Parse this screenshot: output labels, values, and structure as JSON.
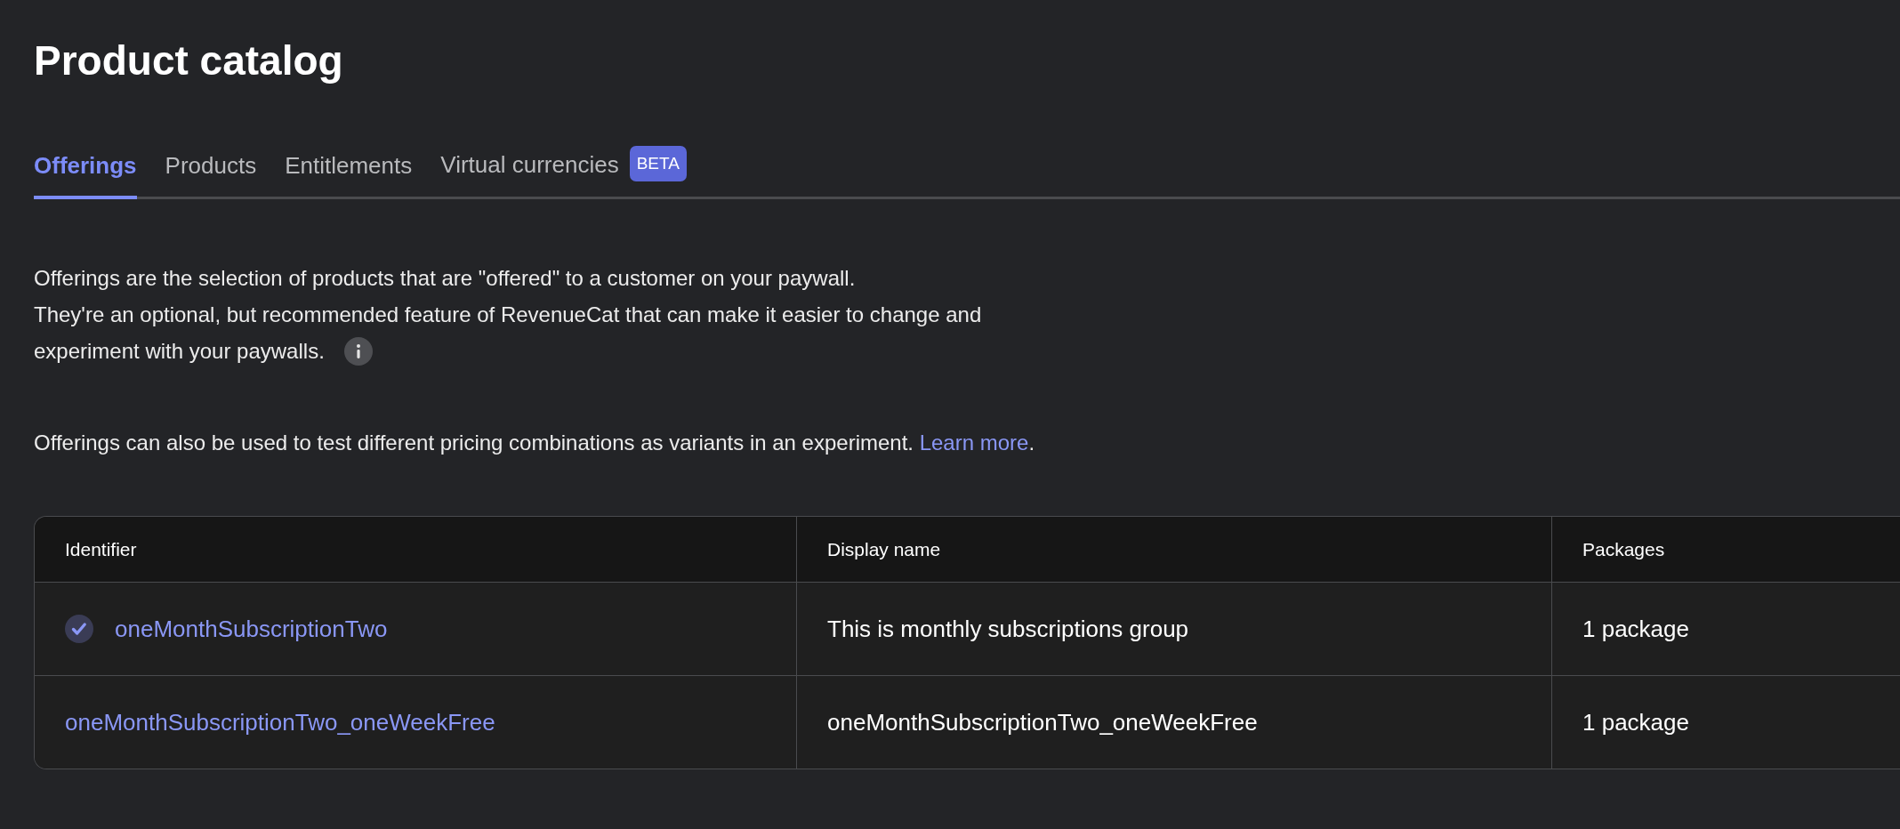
{
  "page_title": "Product catalog",
  "tabs": [
    {
      "label": "Offerings",
      "selected": true
    },
    {
      "label": "Products",
      "selected": false
    },
    {
      "label": "Entitlements",
      "selected": false
    },
    {
      "label": "Virtual currencies",
      "selected": false,
      "badge": "BETA"
    }
  ],
  "intro_lines": [
    "Offerings are the selection of products that are \"offered\" to a customer on your paywall.",
    "They're an optional, but recommended feature of RevenueCat that can make it easier to change and",
    "experiment with your paywalls."
  ],
  "note": {
    "text": "Offerings can also be used to test different pricing combinations as variants in an experiment.",
    "link": "Learn more",
    "after": "."
  },
  "table": {
    "columns": [
      "Identifier",
      "Display name",
      "Packages"
    ],
    "rows": [
      {
        "identifier": "oneMonthSubscriptionTwo",
        "current": true,
        "display_name": "This is monthly subscriptions group",
        "packages": "1 package"
      },
      {
        "identifier": "oneMonthSubscriptionTwo_oneWeekFree",
        "current": false,
        "display_name": "oneMonthSubscriptionTwo_oneWeekFree",
        "packages": "1 package"
      }
    ]
  }
}
